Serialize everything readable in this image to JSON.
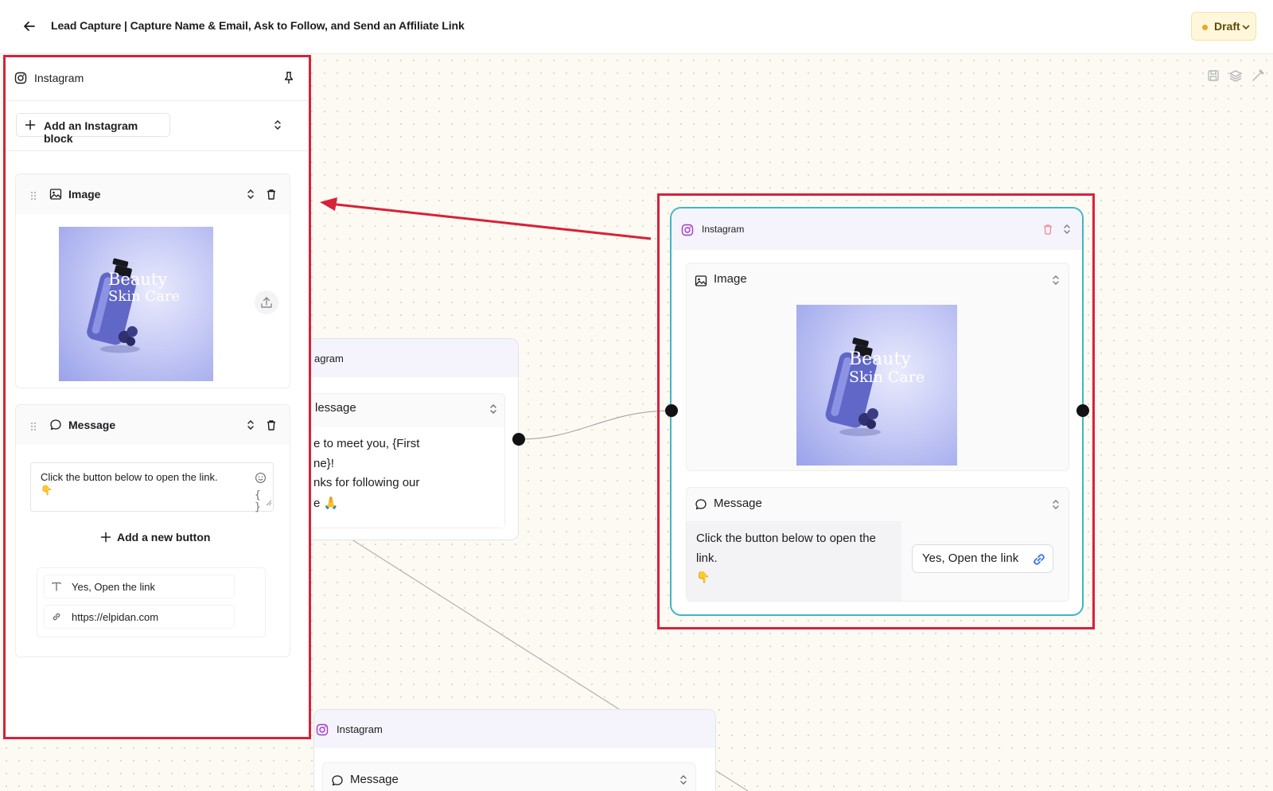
{
  "header": {
    "title": "Lead Capture | Capture Name & Email, Ask to Follow, and Send an Affiliate Link",
    "status": "Draft",
    "status_color": "#e9a825"
  },
  "left_panel": {
    "title": "Instagram",
    "add_block_label": "Add an Instagram block",
    "image_card": {
      "title": "Image",
      "image_alt": "Beauty Skin Care"
    },
    "message_card": {
      "title": "Message",
      "text": "Click the button below to open the link.",
      "emoji": "👇",
      "add_button_label": "Add a new button",
      "button_text": "Yes, Open the link",
      "button_url": "https://elpidan.com"
    }
  },
  "nodes": {
    "partial_node": {
      "header": "agram",
      "block_title": "lessage",
      "lines": [
        "e to meet you, {First",
        "ne}!",
        "nks for following our",
        "e 🙏"
      ]
    },
    "selected_node": {
      "header": "Instagram",
      "image_block_title": "Image",
      "image_text_line1": "Beauty",
      "image_text_line2": "Skin Care",
      "message_block_title": "Message",
      "message_line1": "Click the button below to open the",
      "message_line2": "link.",
      "emoji": "👇",
      "button_label": "Yes, Open the link"
    },
    "bottom_node": {
      "header": "Instagram",
      "block_title": "Message"
    }
  },
  "image_text": {
    "line1": "Beauty",
    "line2": "Skin Care"
  },
  "colors": {
    "highlight_red": "#d8213a",
    "selected_border": "#3fb6c4",
    "instagram_purple": "#a33cc3",
    "link_blue": "#3b72e8"
  },
  "icons": [
    "back-arrow-icon",
    "chevron-down-icon",
    "instagram-icon",
    "pin-icon",
    "plus-icon",
    "sort-icon",
    "drag-handle-icon",
    "image-icon",
    "trash-icon",
    "upload-icon",
    "message-icon",
    "smile-icon",
    "text-icon",
    "link-icon",
    "save-icon",
    "layers-icon",
    "wand-icon"
  ]
}
